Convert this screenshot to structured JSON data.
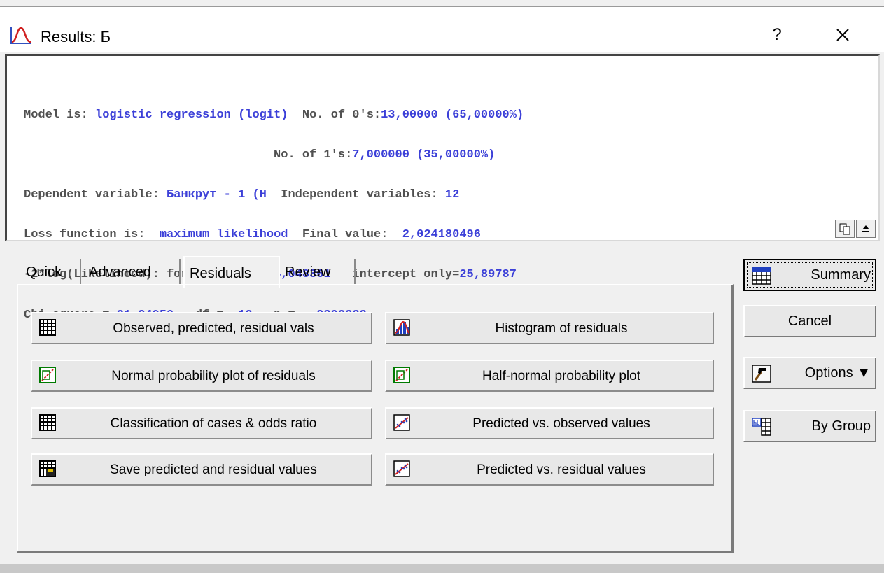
{
  "window": {
    "title": "Results: Б",
    "help_label": "?"
  },
  "results": {
    "line1": {
      "l1": "Model is: ",
      "v1": "logistic regression (logit)",
      "l2": "  No. of 0's:",
      "v2": "13,00000 (65,00000%)"
    },
    "line2": {
      "l1": "                                   No. of 1's:",
      "v1": "7,000000 (35,00000%)"
    },
    "line3": {
      "l1": "Dependent variable: ",
      "v1": "Банкрут - 1 (H",
      "l2": "  Independent variables: ",
      "v2": "12"
    },
    "line4": {
      "l1": "Loss function is:  ",
      "v1": "maximum likelihood",
      "l2": "  Final value:  ",
      "v2": "2,024180496"
    },
    "line5": {
      "l1": "-2*log(Likelihood): for this model=",
      "v1": "4,048361",
      "l2": "   intercept only=",
      "v2": "25,89787"
    },
    "line6": {
      "l1": "Chi-square = ",
      "v1": "21,84950",
      "l2": "   df =  ",
      "v2": "12",
      "l3": "   p =  ",
      "v3": ",0392888"
    }
  },
  "tabs": [
    "Quick",
    "Advanced",
    "Residuals",
    "Review"
  ],
  "active_tab": "Residuals",
  "residual_buttons": [
    {
      "label": "Observed, predicted, residual vals",
      "icon": "spreadsheet-icon"
    },
    {
      "label": "Histogram of residuals",
      "icon": "histogram-icon"
    },
    {
      "label": "Normal probability plot of residuals",
      "icon": "probability-plot-icon"
    },
    {
      "label": "Half-normal probability plot",
      "icon": "probability-plot-icon"
    },
    {
      "label": "Classification of cases & odds ratio",
      "icon": "spreadsheet-icon"
    },
    {
      "label": "Predicted vs. observed values",
      "icon": "scatterplot-icon"
    },
    {
      "label": "Save predicted and residual values",
      "icon": "save-spreadsheet-icon"
    },
    {
      "label": "Predicted vs. residual values",
      "icon": "scatterplot-icon"
    }
  ],
  "side_buttons": {
    "summary": "Summary",
    "cancel": "Cancel",
    "options": "Options ▼",
    "by_group": "By Group"
  },
  "colors": {
    "value_text": "#3c40d8",
    "label_text": "#505050",
    "dialog_bg": "#f0f0f0"
  }
}
